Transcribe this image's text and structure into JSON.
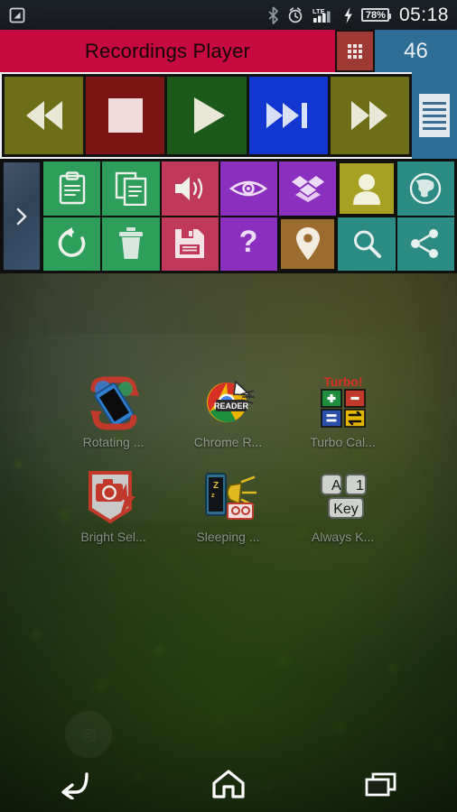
{
  "statusbar": {
    "icons": [
      "app-notification-icon",
      "bluetooth-icon",
      "alarm-clock-icon",
      "lte-signal-icon",
      "charging-bolt-icon"
    ],
    "network_label": "LTE",
    "battery_percent": "78%",
    "clock": "05:18"
  },
  "app": {
    "title": "Recordings Player",
    "grid_button": "grid-icon",
    "count": "46",
    "colors": {
      "title_bar": "#c60a40",
      "grid_button": "#9e3a33",
      "count_panel": "#2e6d96",
      "rewind": "#6e6e16",
      "stop": "#7a1515",
      "play": "#1c5a1b",
      "next": "#1236d0",
      "forward": "#6e6e16",
      "green_tile": "#2e9e5b",
      "crimson_tile": "#c0395a",
      "purple_tile": "#8b2fbe",
      "olive_tile": "#a8a022",
      "teal_tile": "#2d8b85",
      "brown_tile": "#9c6b2e"
    },
    "transport": [
      {
        "name": "rewind-button",
        "icon": "rewind-icon",
        "color_class": "rew"
      },
      {
        "name": "stop-button",
        "icon": "stop-icon",
        "color_class": "stop"
      },
      {
        "name": "play-button",
        "icon": "play-icon",
        "color_class": "play"
      },
      {
        "name": "next-button",
        "icon": "next-track-icon",
        "color_class": "next"
      },
      {
        "name": "forward-button",
        "icon": "fast-forward-icon",
        "color_class": "ffwd"
      }
    ],
    "side_rail": {
      "icon": "list-lines-icon"
    },
    "drawer_handle": {
      "icon": "chevron-right-icon"
    },
    "tiles_row1": [
      {
        "name": "clipboard-tile",
        "icon": "clipboard-icon",
        "color_class": "t-green"
      },
      {
        "name": "copy-tile",
        "icon": "copy-files-icon",
        "color_class": "t-green"
      },
      {
        "name": "volume-tile",
        "icon": "speaker-icon",
        "color_class": "t-crimson"
      },
      {
        "name": "preview-tile",
        "icon": "eye-icon",
        "color_class": "t-purple"
      },
      {
        "name": "dropbox-tile",
        "icon": "dropbox-icon",
        "color_class": "t-purple"
      },
      {
        "name": "contact-tile",
        "icon": "person-icon",
        "color_class": "t-olive"
      },
      {
        "name": "browser-tile",
        "icon": "globe-icon",
        "color_class": "t-teal"
      }
    ],
    "tiles_row2": [
      {
        "name": "refresh-tile",
        "icon": "refresh-icon",
        "color_class": "t-green"
      },
      {
        "name": "delete-tile",
        "icon": "trash-icon",
        "color_class": "t-green"
      },
      {
        "name": "save-tile",
        "icon": "floppy-save-icon",
        "color_class": "t-crimson"
      },
      {
        "name": "help-tile",
        "icon": "question-mark-icon",
        "color_class": "t-purple"
      },
      {
        "name": "location-tile",
        "icon": "map-pin-icon",
        "color_class": "t-brown"
      },
      {
        "name": "search-tile",
        "icon": "magnifier-icon",
        "color_class": "t-teal"
      },
      {
        "name": "share-tile",
        "icon": "share-nodes-icon",
        "color_class": "t-teal"
      }
    ]
  },
  "desktop": {
    "rows": [
      [
        {
          "name": "app-rotating",
          "label": "Rotating ...",
          "icon": "rotating-screen-icon"
        },
        {
          "name": "app-chrome-reader",
          "label": "Chrome R...",
          "icon": "chrome-reader-icon"
        },
        {
          "name": "app-turbo-calc",
          "label": "Turbo Cal...",
          "icon": "turbo-calculator-icon"
        }
      ],
      [
        {
          "name": "app-bright-selfie",
          "label": "Bright Sel...",
          "icon": "bright-selfie-icon"
        },
        {
          "name": "app-sleeping",
          "label": "Sleeping ...",
          "icon": "sleeping-alarm-icon"
        },
        {
          "name": "app-always-key",
          "label": "Always K...",
          "icon": "always-key-icon"
        }
      ]
    ],
    "always_key_glyphs": [
      "A",
      "1",
      "Key"
    ],
    "turbo_label": "Turbo!",
    "reader_label": "READER"
  },
  "navbar": {
    "items": [
      {
        "name": "nav-back-button",
        "icon": "back-arrow-icon"
      },
      {
        "name": "nav-home-button",
        "icon": "home-icon"
      },
      {
        "name": "nav-recents-button",
        "icon": "recents-icon"
      }
    ]
  }
}
